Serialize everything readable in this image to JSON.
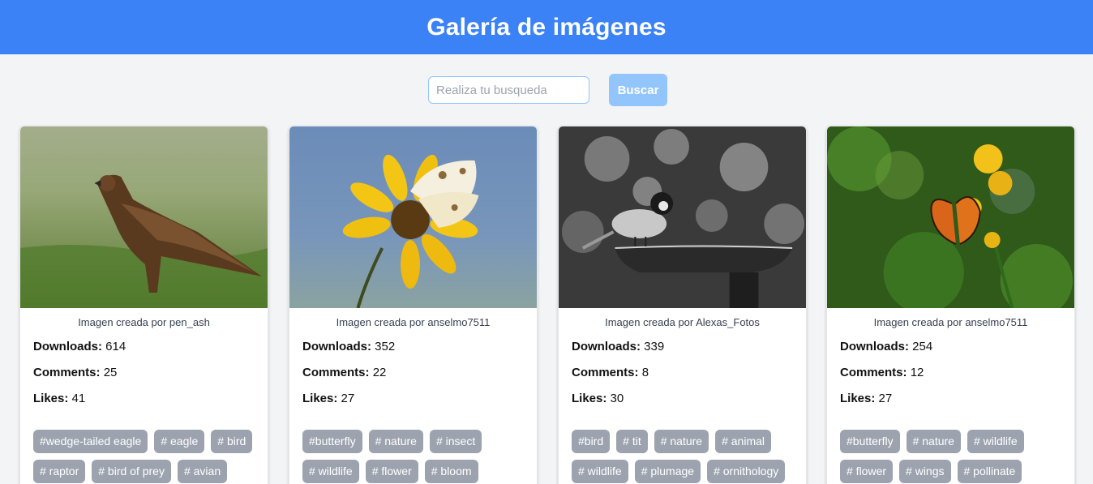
{
  "header": {
    "title": "Galería de imágenes"
  },
  "search": {
    "placeholder": "Realiza tu busqueda",
    "value": "",
    "button_label": "Buscar"
  },
  "stat_labels": {
    "downloads": "Downloads:",
    "comments": "Comments:",
    "likes": "Likes:"
  },
  "cards": [
    {
      "credit": "Imagen creada por pen_ash",
      "downloads": "614",
      "comments": "25",
      "likes": "41",
      "tags": [
        "#wedge-tailed eagle",
        "# eagle",
        "# bird",
        "# raptor",
        "# bird of prey",
        "# avian"
      ]
    },
    {
      "credit": "Imagen creada por anselmo7511",
      "downloads": "352",
      "comments": "22",
      "likes": "27",
      "tags": [
        "#butterfly",
        "# nature",
        "# insect",
        "# wildlife",
        "# flower",
        "# bloom"
      ]
    },
    {
      "credit": "Imagen creada por Alexas_Fotos",
      "downloads": "339",
      "comments": "8",
      "likes": "30",
      "tags": [
        "#bird",
        "# tit",
        "# nature",
        "# animal",
        "# wildlife",
        "# plumage",
        "# ornithology"
      ]
    },
    {
      "credit": "Imagen creada por anselmo7511",
      "downloads": "254",
      "comments": "12",
      "likes": "27",
      "tags": [
        "#butterfly",
        "# nature",
        "# wildlife",
        "# flower",
        "# wings",
        "# pollinate"
      ]
    }
  ]
}
